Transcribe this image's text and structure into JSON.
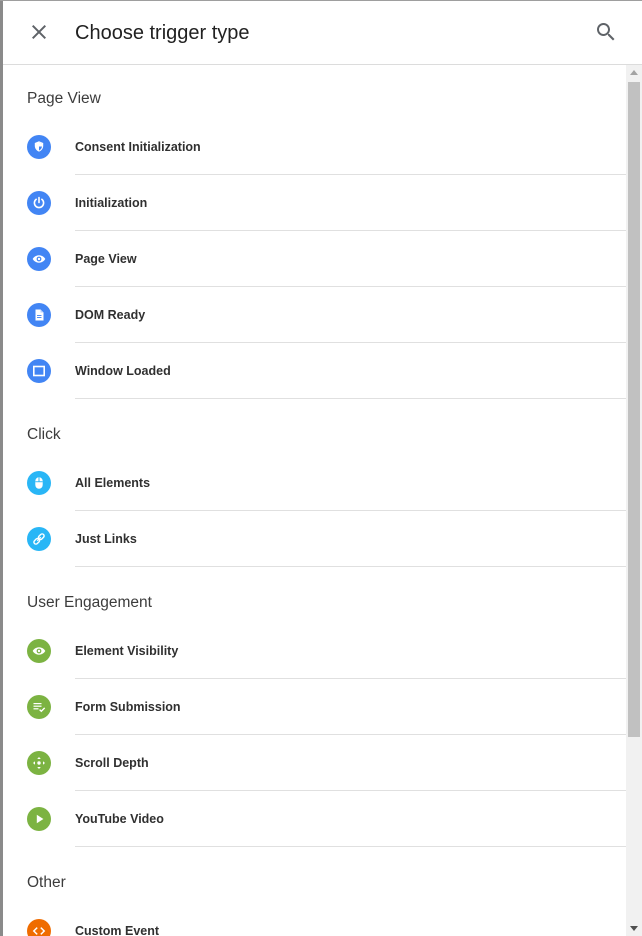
{
  "header": {
    "title": "Choose trigger type",
    "close_icon": "close-icon",
    "search_icon": "search-icon"
  },
  "colors": {
    "page_view": "#4285f4",
    "click": "#29b6f6",
    "user_engagement": "#7cb342",
    "other": "#ef6c00"
  },
  "sections": [
    {
      "title": "Page View",
      "items": [
        {
          "label": "Consent Initialization",
          "icon": "shield-icon"
        },
        {
          "label": "Initialization",
          "icon": "power-icon"
        },
        {
          "label": "Page View",
          "icon": "eye-icon"
        },
        {
          "label": "DOM Ready",
          "icon": "document-icon"
        },
        {
          "label": "Window Loaded",
          "icon": "window-icon"
        }
      ]
    },
    {
      "title": "Click",
      "items": [
        {
          "label": "All Elements",
          "icon": "mouse-icon"
        },
        {
          "label": "Just Links",
          "icon": "link-icon"
        }
      ]
    },
    {
      "title": "User Engagement",
      "items": [
        {
          "label": "Element Visibility",
          "icon": "eye-icon"
        },
        {
          "label": "Form Submission",
          "icon": "form-check-icon"
        },
        {
          "label": "Scroll Depth",
          "icon": "move-arrows-icon"
        },
        {
          "label": "YouTube Video",
          "icon": "play-icon"
        }
      ]
    },
    {
      "title": "Other",
      "items": [
        {
          "label": "Custom Event",
          "icon": "code-icon"
        }
      ]
    }
  ]
}
